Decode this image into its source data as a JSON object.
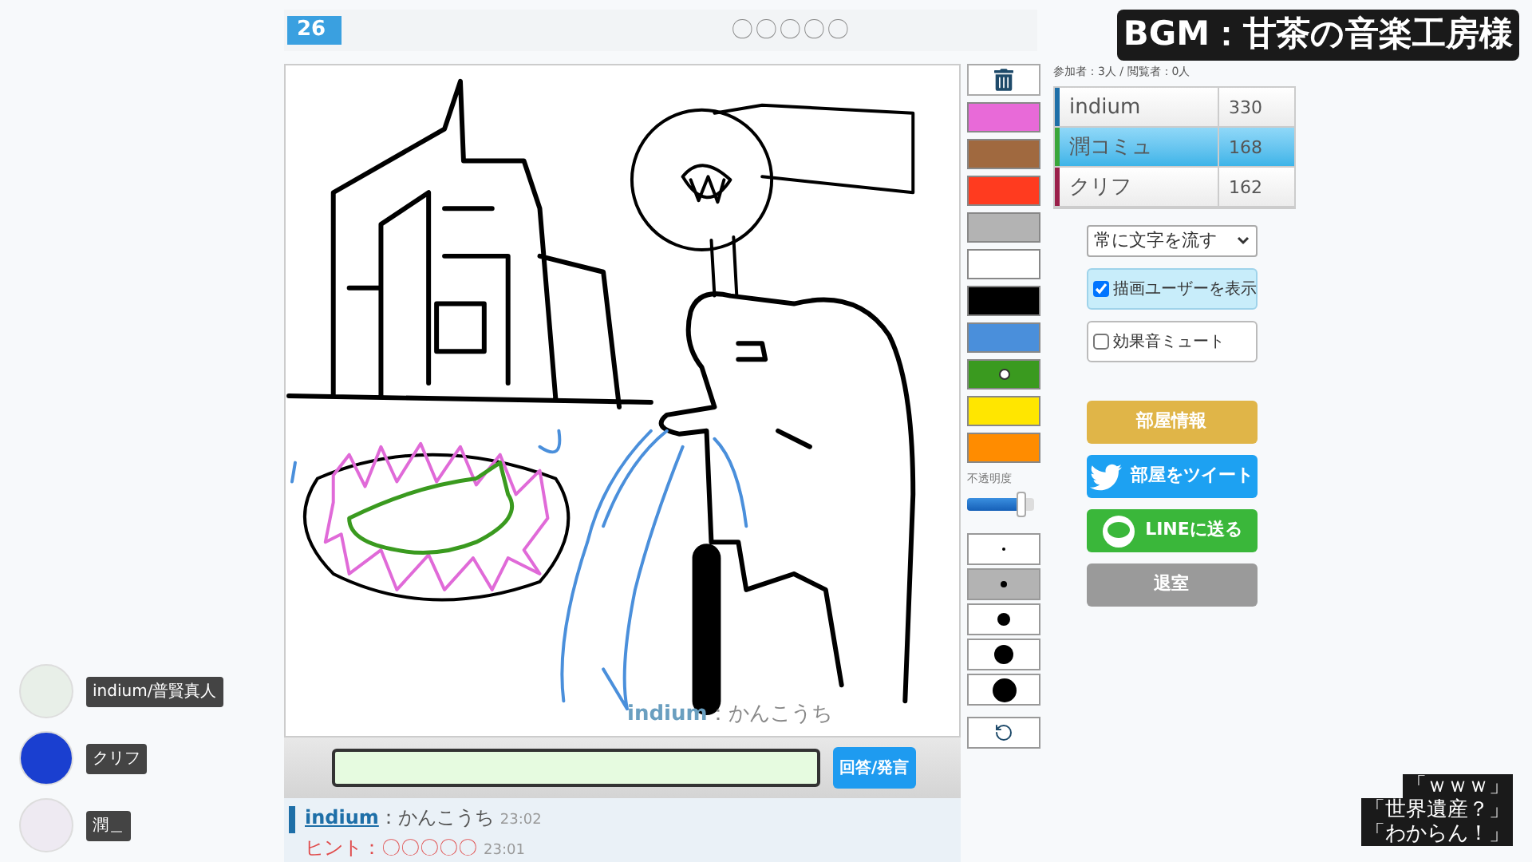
{
  "top_bar": {
    "timer": "26",
    "hint": "〇〇〇〇〇"
  },
  "bgm_caption": "BGM：甘茶の音楽工房様",
  "canvas": {
    "caption_user": "indium",
    "caption_text": "：かんこうち"
  },
  "palette": [
    {
      "color": "#e86ad8",
      "selected": false
    },
    {
      "color": "#a0693f",
      "selected": false
    },
    {
      "color": "#ff3b1f",
      "selected": false
    },
    {
      "color": "#b3b3b3",
      "selected": false
    },
    {
      "color": "#ffffff",
      "selected": false
    },
    {
      "color": "#000000",
      "selected": false
    },
    {
      "color": "#4a8fdb",
      "selected": false
    },
    {
      "color": "#3a9a1f",
      "selected": true
    },
    {
      "color": "#ffe600",
      "selected": false
    },
    {
      "color": "#ff8c00",
      "selected": false
    }
  ],
  "opacity": {
    "label": "不透明度",
    "level": 0.8
  },
  "pen_sizes": [
    {
      "selected": false
    },
    {
      "selected": true
    },
    {
      "selected": false
    },
    {
      "selected": false
    },
    {
      "selected": false
    }
  ],
  "room": {
    "counts": "参加者：3人 / 閲覧者：0人",
    "players": [
      {
        "name": "indium",
        "score": "330",
        "color": "#1e6fa8",
        "selected": false
      },
      {
        "name": "潤コミュ",
        "score": "168",
        "color": "#3aa63a",
        "selected": true
      },
      {
        "name": "クリフ",
        "score": "162",
        "color": "#9a1f4a",
        "selected": false
      }
    ],
    "mode_select": "常に文字を流す",
    "options": [
      {
        "label": "描画ユーザーを表示",
        "checked": true
      },
      {
        "label": "効果音ミュート",
        "checked": false
      }
    ],
    "buttons": [
      {
        "label": "部屋情報",
        "kind": "info"
      },
      {
        "label": "部屋をツイート",
        "kind": "tweet"
      },
      {
        "label": "LINEに送る",
        "kind": "line"
      },
      {
        "label": "退室",
        "kind": "leave"
      }
    ]
  },
  "answer": {
    "button": "回答/発言"
  },
  "chat": [
    {
      "kind": "user",
      "user": "indium",
      "text": "：かんこうち",
      "time": "23:02"
    },
    {
      "kind": "hint",
      "text": "ヒント：〇〇〇〇〇",
      "time": "23:01"
    }
  ],
  "viewers": [
    {
      "name": "indium/普賢真人",
      "color": "#e8efe8"
    },
    {
      "name": "クリフ",
      "color": "#1a3fd0"
    },
    {
      "name": "潤＿",
      "color": "#eeeaf2"
    }
  ],
  "comments": [
    "「ｗｗｗ」",
    "「世界遺産？」",
    "「わからん！」"
  ]
}
